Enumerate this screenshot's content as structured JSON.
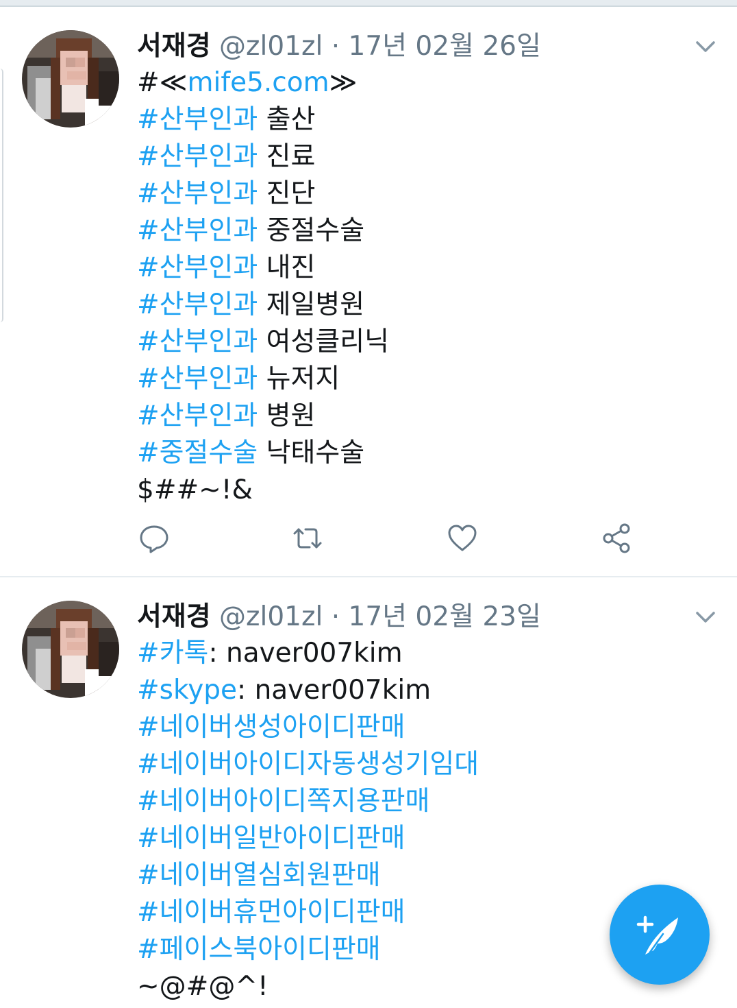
{
  "tweets": [
    {
      "name": "서재경",
      "handle": "@zl01zl",
      "separator": "·",
      "date": "17년 02월 26일",
      "lines": [
        [
          {
            "t": "#≪",
            "k": "txt"
          },
          {
            "t": "mife5.com",
            "k": "tag"
          },
          {
            "t": "≫",
            "k": "txt"
          }
        ],
        [
          {
            "t": "#산부인과",
            "k": "tag"
          },
          {
            "t": " 출산",
            "k": "txt"
          }
        ],
        [
          {
            "t": "#산부인과",
            "k": "tag"
          },
          {
            "t": " 진료",
            "k": "txt"
          }
        ],
        [
          {
            "t": "#산부인과",
            "k": "tag"
          },
          {
            "t": " 진단",
            "k": "txt"
          }
        ],
        [
          {
            "t": "#산부인과",
            "k": "tag"
          },
          {
            "t": " 중절수술",
            "k": "txt"
          }
        ],
        [
          {
            "t": "#산부인과",
            "k": "tag"
          },
          {
            "t": " 내진",
            "k": "txt"
          }
        ],
        [
          {
            "t": "#산부인과",
            "k": "tag"
          },
          {
            "t": " 제일병원",
            "k": "txt"
          }
        ],
        [
          {
            "t": "#산부인과",
            "k": "tag"
          },
          {
            "t": " 여성클리닉",
            "k": "txt"
          }
        ],
        [
          {
            "t": "#산부인과",
            "k": "tag"
          },
          {
            "t": " 뉴저지",
            "k": "txt"
          }
        ],
        [
          {
            "t": "#산부인과",
            "k": "tag"
          },
          {
            "t": " 병원",
            "k": "txt"
          }
        ],
        [
          {
            "t": "#중절수술",
            "k": "tag"
          },
          {
            "t": " 낙태수술",
            "k": "txt"
          }
        ],
        [
          {
            "t": "$##~!&",
            "k": "txt"
          }
        ]
      ],
      "actions": [
        "reply-icon",
        "retweet-icon",
        "like-icon",
        "share-icon"
      ]
    },
    {
      "name": "서재경",
      "handle": "@zl01zl",
      "separator": "·",
      "date": "17년 02월 23일",
      "lines": [
        [
          {
            "t": "#카톡",
            "k": "tag"
          },
          {
            "t": ": naver007kim",
            "k": "txt"
          }
        ],
        [
          {
            "t": "#skype",
            "k": "tag"
          },
          {
            "t": ": naver007kim",
            "k": "txt"
          }
        ],
        [
          {
            "t": "#네이버생성아이디판매",
            "k": "tag"
          }
        ],
        [
          {
            "t": "#네이버아이디자동생성기임대",
            "k": "tag"
          }
        ],
        [
          {
            "t": "#네이버아이디쪽지용판매",
            "k": "tag"
          }
        ],
        [
          {
            "t": "#네이버일반아이디판매",
            "k": "tag"
          }
        ],
        [
          {
            "t": "#네이버열심회원판매",
            "k": "tag"
          }
        ],
        [
          {
            "t": "#네이버휴먼아이디판매",
            "k": "tag"
          }
        ],
        [
          {
            "t": "#페이스북아이디판매",
            "k": "tag"
          }
        ],
        [
          {
            "t": "~@#@^!",
            "k": "txt"
          }
        ]
      ]
    }
  ],
  "fab": {
    "icon": "compose-tweet-icon"
  },
  "colors": {
    "accent": "#1da1f2",
    "muted": "#657786",
    "text": "#14171a"
  }
}
